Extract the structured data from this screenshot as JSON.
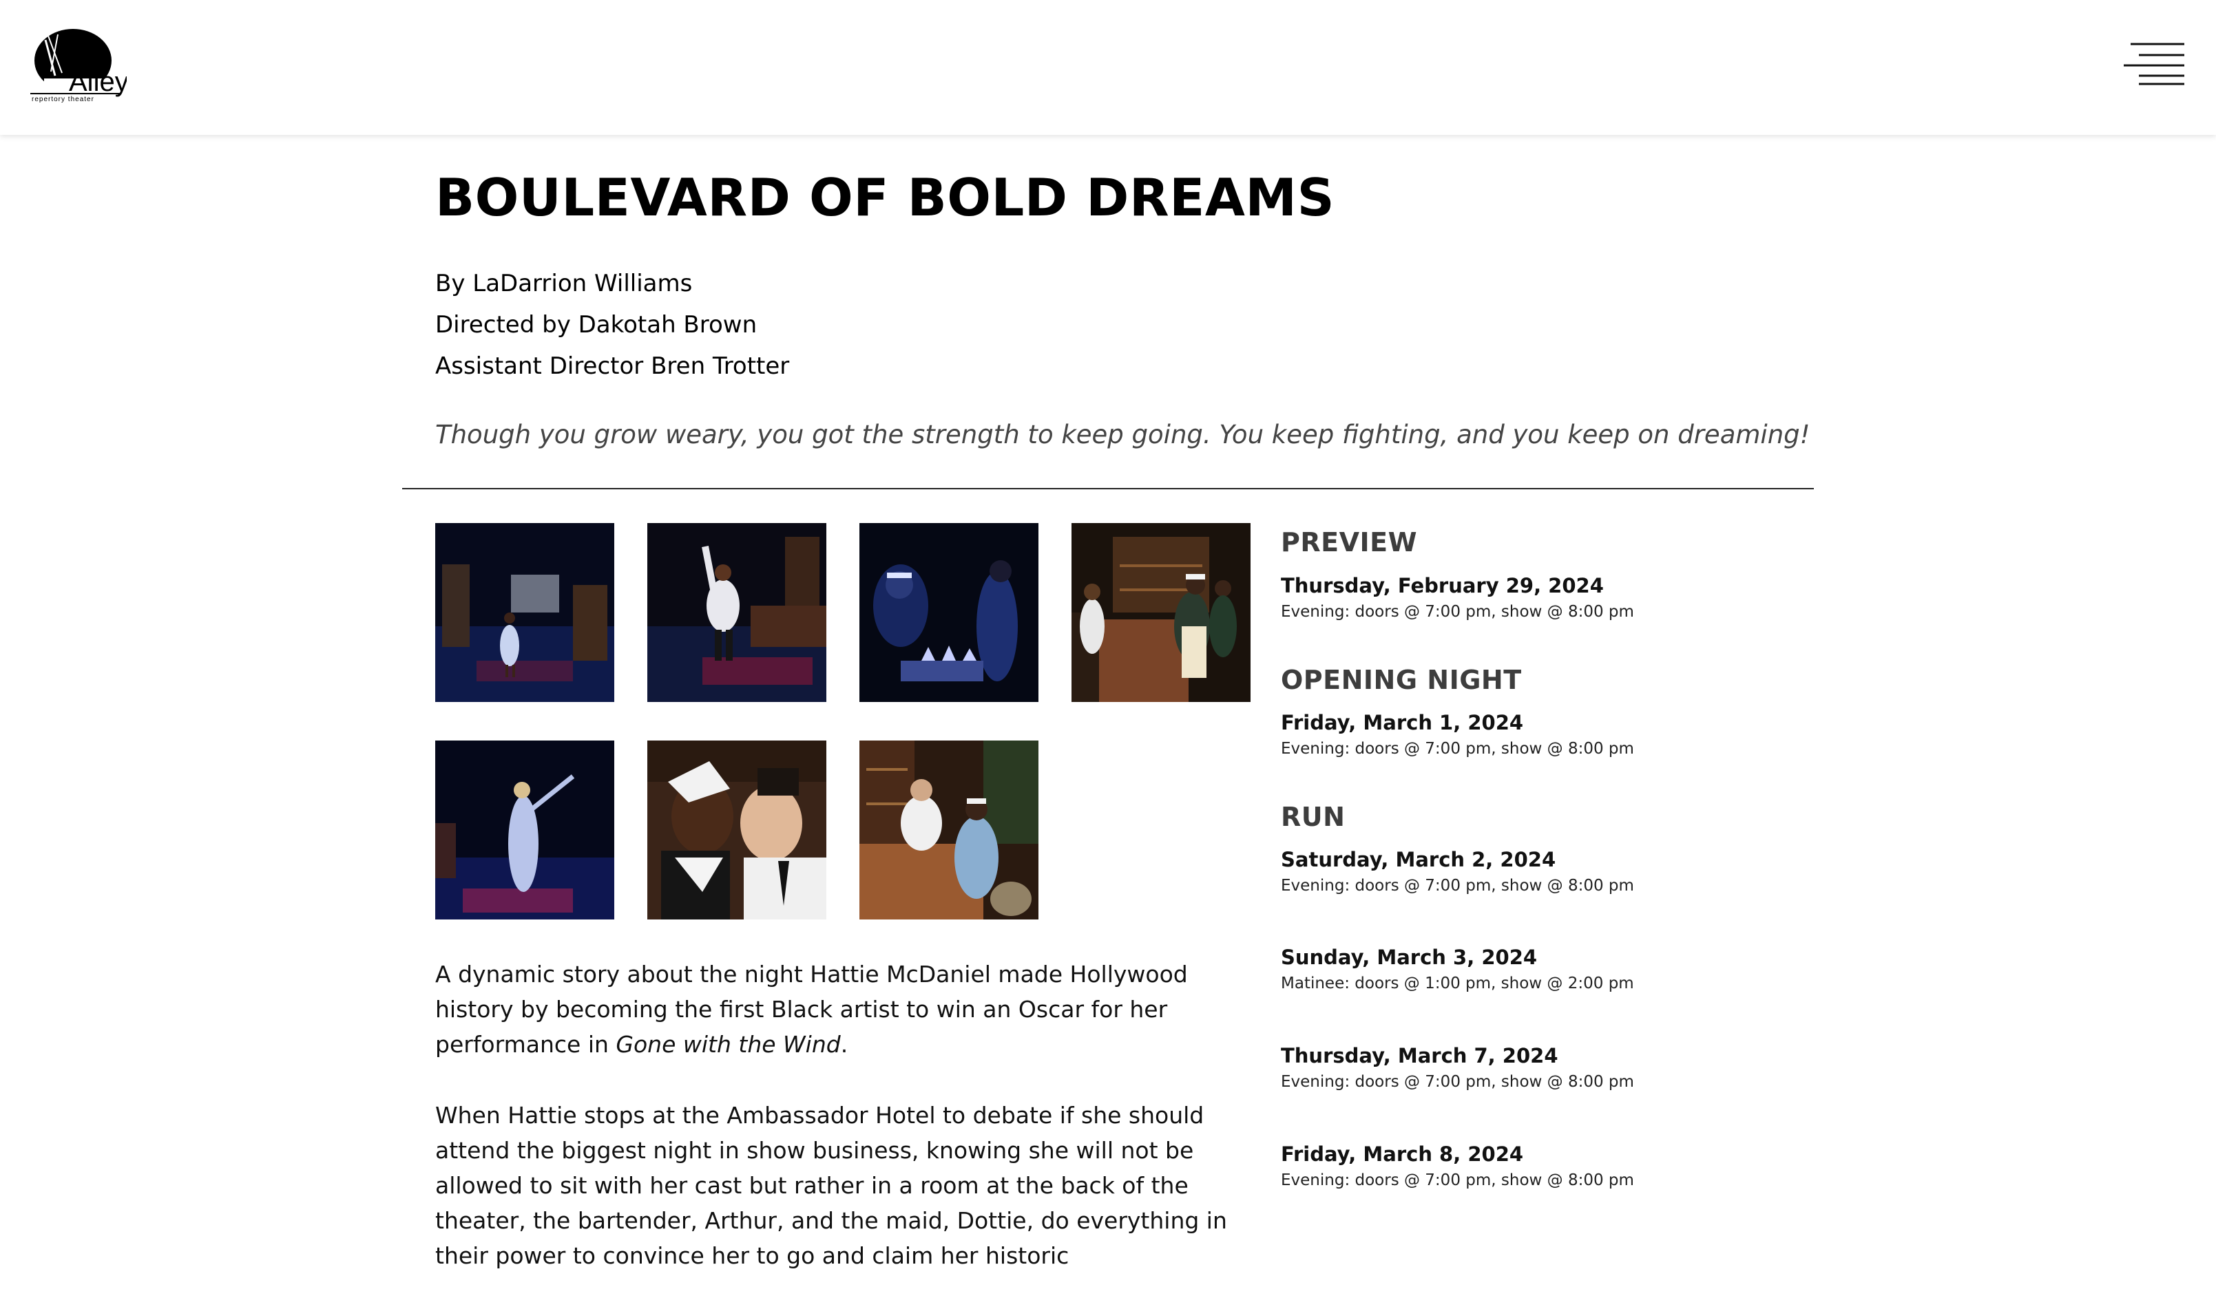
{
  "header": {
    "logo_text": "Alley",
    "logo_subtext": "repertory theater",
    "menu_icon": "hamburger-menu-icon"
  },
  "show": {
    "title": "BOULEVARD OF BOLD DREAMS",
    "author": "By LaDarrion Williams",
    "director": "Directed by Dakotah Brown",
    "assistant_director": "Assistant Director Bren Trotter",
    "tagline": "Though you grow weary, you got the strength to keep going. You keep fighting, and you keep on dreaming!"
  },
  "gallery": {
    "photos": [
      "production-photo-1",
      "production-photo-2",
      "production-photo-3",
      "production-photo-4",
      "production-photo-5",
      "production-photo-6",
      "production-photo-7"
    ]
  },
  "description": {
    "p1_a": "A dynamic story about the night Hattie McDaniel made Hollywood history by becoming the first Black artist to win an Oscar for her performance in ",
    "p1_italic": "Gone with the Wind",
    "p1_b": ".",
    "p2": "When Hattie stops at the Ambassador Hotel to debate if she should attend the biggest night in show business, knowing she will not be allowed to sit with her cast but rather in a room at the back of the theater, the bartender, Arthur, and the maid, Dottie, do everything in their power to convince her to go and claim her historic"
  },
  "schedule": {
    "preview": {
      "heading": "PREVIEW",
      "date": "Thursday, February 29, 2024",
      "time": "Evening: doors @ 7:00 pm, show @ 8:00 pm"
    },
    "opening": {
      "heading": "OPENING NIGHT",
      "date": "Friday, March 1, 2024",
      "time": "Evening: doors @ 7:00 pm, show @ 8:00 pm"
    },
    "run": {
      "heading": "RUN",
      "performances": [
        {
          "date": "Saturday, March 2, 2024",
          "time": "Evening: doors @ 7:00 pm, show @ 8:00 pm"
        },
        {
          "date": "Sunday, March 3, 2024",
          "time": "Matinee: doors @ 1:00 pm, show @ 2:00 pm"
        },
        {
          "date": "Thursday, March 7, 2024",
          "time": "Evening: doors @ 7:00 pm, show @ 8:00 pm"
        },
        {
          "date": "Friday, March 8, 2024",
          "time": "Evening: doors @ 7:00 pm, show @ 8:00 pm"
        }
      ]
    }
  }
}
